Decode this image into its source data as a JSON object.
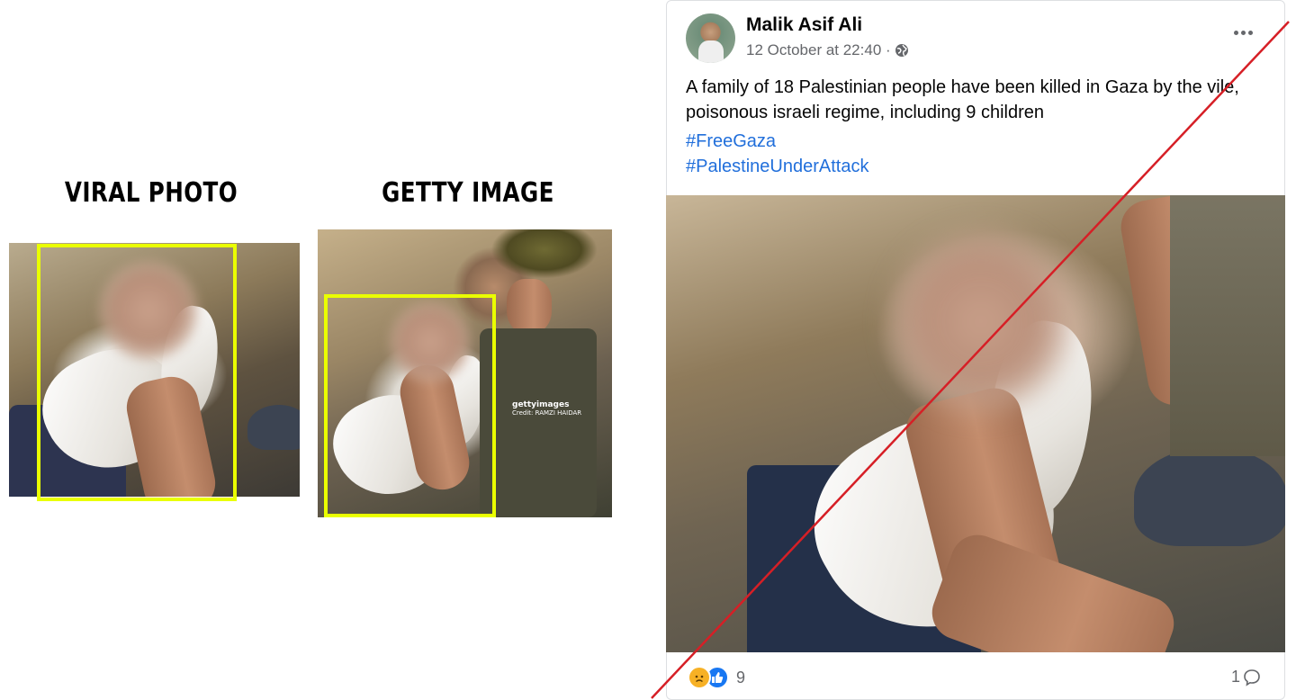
{
  "comparison": {
    "left_heading": "VIRAL PHOTO",
    "right_heading": "GETTY IMAGE",
    "highlight_color": "#eaff00",
    "getty_watermark_brand": "gettyimages",
    "getty_watermark_credit": "Credit: RAMZI HAIDAR"
  },
  "post": {
    "author": "Malik Asif Ali",
    "timestamp": "12 October at 22:40 ·",
    "text": "A family of 18 Palestinian people have been killed in Gaza by the vile, poisonous israeli regime, including 9 children",
    "hashtags": [
      "#FreeGaza",
      "#PalestineUnderAttack"
    ],
    "reaction_count": "9",
    "comment_count": "1",
    "icons": [
      "more-icon",
      "globe-icon",
      "sad-reaction-icon",
      "like-reaction-icon",
      "comment-icon"
    ]
  },
  "colors": {
    "strike_line": "#d61f26",
    "link": "#216fdb",
    "secondary_text": "#65676b"
  }
}
